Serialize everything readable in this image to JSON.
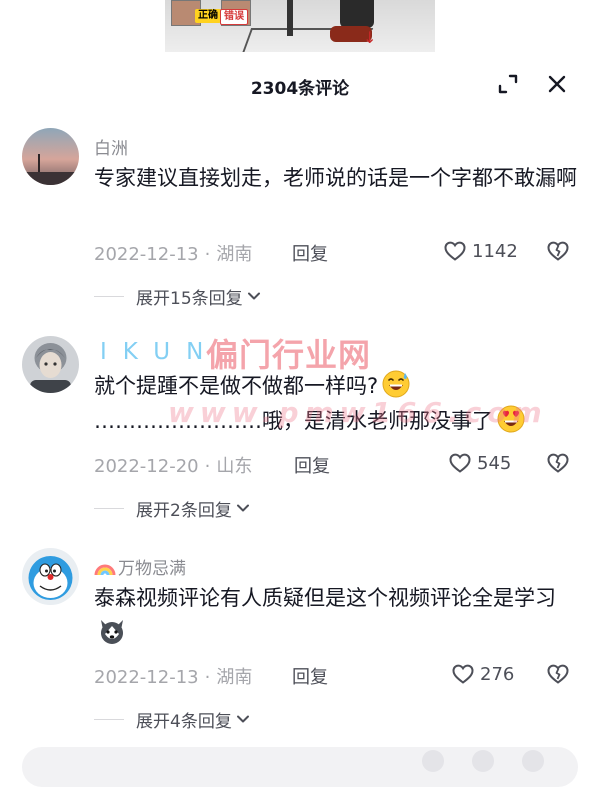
{
  "header": {
    "title": "2304条评论",
    "expand_icon": "expand-icon",
    "close_icon": "close-icon"
  },
  "video": {
    "tag_correct": "正确",
    "tag_wrong": "错误"
  },
  "watermark": {
    "ikun": "IKUN",
    "title": "偏门行业网",
    "url": "www.pmw166.com"
  },
  "comments": [
    {
      "author": "白洲",
      "text": "专家建议直接划走，老师说的话是一个字都不敢漏啊",
      "date": "2022-12-13",
      "location": "湖南",
      "reply_label": "回复",
      "likes": "1142",
      "replies_label": "展开15条回复"
    },
    {
      "author": "",
      "text_line1": "就个提踵不是做不做都一样吗?",
      "text_line2": "……………………哦，是清水老师那没事了",
      "date": "2022-12-20",
      "location": "山东",
      "reply_label": "回复",
      "likes": "545",
      "replies_label": "展开2条回复"
    },
    {
      "author": "万物忌满",
      "text": "泰森视频评论有人质疑但是这个视频评论全是学习",
      "date": "2022-12-13",
      "location": "湖南",
      "reply_label": "回复",
      "likes": "276",
      "replies_label": "展开4条回复"
    }
  ],
  "colors": {
    "text_primary": "#161823",
    "text_secondary": "#8a8b91",
    "watermark_red": "#e73544",
    "watermark_blue": "#6ec7f2"
  }
}
